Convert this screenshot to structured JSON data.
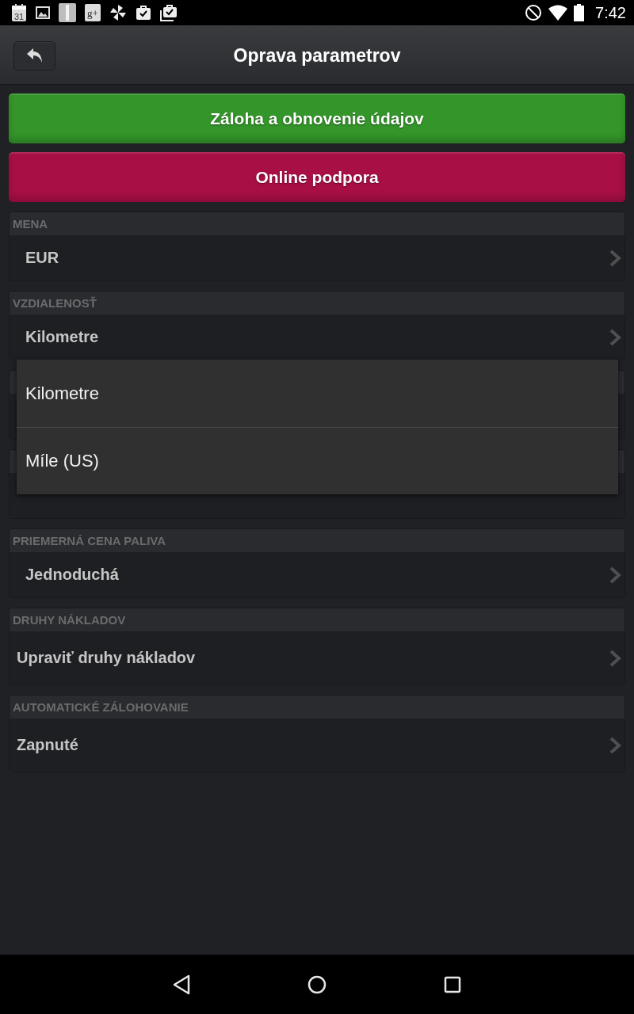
{
  "status_bar": {
    "notifications": [
      {
        "kind": "calendar",
        "text": "31"
      },
      {
        "kind": "image"
      },
      {
        "kind": "tile"
      },
      {
        "kind": "gplus",
        "text": "g+"
      },
      {
        "kind": "pinwheel"
      },
      {
        "kind": "bag"
      },
      {
        "kind": "bag-stack"
      }
    ],
    "time": "7:42"
  },
  "action_bar": {
    "title": "Oprava parametrov"
  },
  "buttons": [
    {
      "label": "Záloha a obnovenie údajov",
      "color": "#34962a"
    },
    {
      "label": "Online podpora",
      "color": "#a80f45"
    }
  ],
  "sections": [
    {
      "header": "MENA",
      "row": {
        "kind": "picker",
        "value": "EUR"
      }
    },
    {
      "header": "VZDIALENOSŤ",
      "row": {
        "kind": "picker",
        "value": "Kilometre"
      },
      "dropdown": {
        "options": [
          "Kilometre",
          "Míle (US)"
        ]
      }
    },
    {
      "row": {
        "kind": "picker"
      }
    },
    {
      "row": {
        "kind": "picker"
      }
    },
    {
      "header": "PRIEMERNÁ CENA PALIVA",
      "row": {
        "kind": "picker",
        "value": "Jednoduchá"
      }
    },
    {
      "header": "DRUHY NÁKLADOV",
      "row": {
        "kind": "link",
        "value": "Upraviť druhy nákladov"
      }
    },
    {
      "header": "AUTOMATICKÉ ZÁLOHOVANIE",
      "row": {
        "kind": "link",
        "value": "Zapnuté"
      }
    }
  ]
}
